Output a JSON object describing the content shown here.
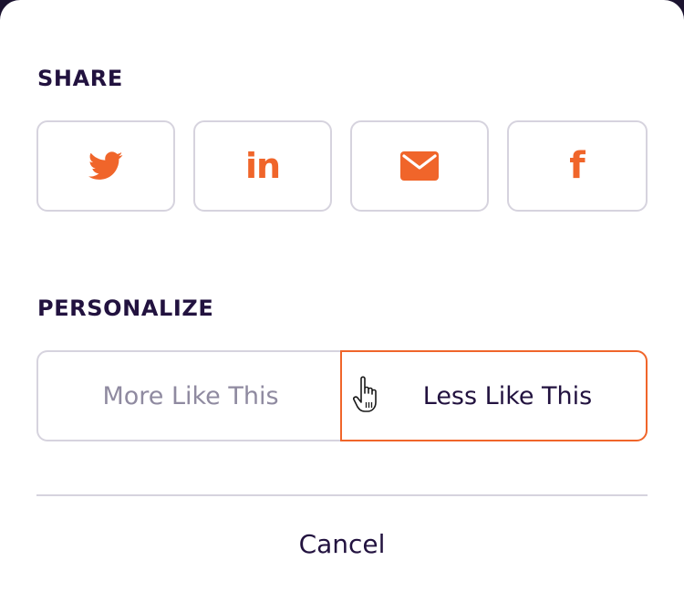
{
  "share": {
    "title": "SHARE",
    "buttons": [
      {
        "name": "twitter",
        "icon": "twitter-icon"
      },
      {
        "name": "linkedin",
        "icon": "linkedin-icon",
        "glyph": "in"
      },
      {
        "name": "email",
        "icon": "envelope-icon"
      },
      {
        "name": "facebook",
        "icon": "facebook-icon",
        "glyph": "f"
      }
    ]
  },
  "personalize": {
    "title": "PERSONALIZE",
    "options": [
      {
        "label": "More Like This",
        "selected": false
      },
      {
        "label": "Less Like This",
        "selected": true
      }
    ]
  },
  "cancel_label": "Cancel",
  "colors": {
    "accent": "#f0652a",
    "text_dark": "#22123f",
    "text_muted": "#8f8aa0",
    "border": "#d6d3de"
  }
}
